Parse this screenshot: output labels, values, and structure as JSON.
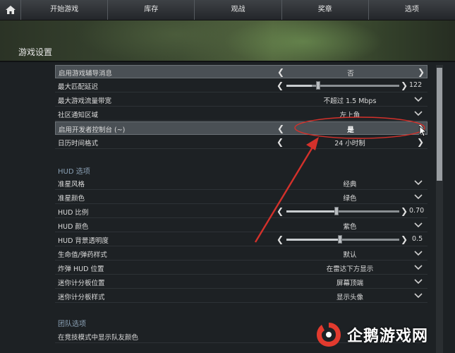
{
  "nav": {
    "items": [
      "开始游戏",
      "库存",
      "观战",
      "奖章",
      "选项"
    ]
  },
  "header": {
    "title": "游戏设置"
  },
  "settings": [
    {
      "label": "启用游戏辅导消息",
      "value": "否",
      "control": "cycle",
      "highlight": true
    },
    {
      "label": "最大匹配延迟",
      "value": "122",
      "control": "slider",
      "level": 0.3
    },
    {
      "label": "最大游戏流量带宽",
      "value": "不超过 1.5 Mbps",
      "control": "dropdown"
    },
    {
      "label": "社区通知区域",
      "value": "左上角",
      "control": "dropdown"
    },
    {
      "label": "启用开发者控制台 (~)",
      "value": "是",
      "control": "cycle",
      "highlight": true
    },
    {
      "label": "日历时间格式",
      "value": "24 小时制",
      "control": "cycle"
    }
  ],
  "hud": {
    "section_title": "HUD 选项",
    "rows": [
      {
        "label": "准星风格",
        "value": "经典",
        "control": "dropdown"
      },
      {
        "label": "准星颜色",
        "value": "绿色",
        "control": "dropdown"
      },
      {
        "label": "HUD 比例",
        "value": "0.70",
        "control": "slider",
        "level": 0.45
      },
      {
        "label": "HUD 颜色",
        "value": "紫色",
        "control": "dropdown"
      },
      {
        "label": "HUD 背景透明度",
        "value": "0.5",
        "control": "slider",
        "level": 0.48
      },
      {
        "label": "生命值/弹药样式",
        "value": "默认",
        "control": "dropdown"
      },
      {
        "label": "炸弹 HUD 位置",
        "value": "在雷达下方显示",
        "control": "dropdown"
      },
      {
        "label": "迷你计分板位置",
        "value": "屏幕顶端",
        "control": "dropdown"
      },
      {
        "label": "迷你计分板样式",
        "value": "显示头像",
        "control": "dropdown"
      }
    ]
  },
  "team": {
    "section_title": "团队选项",
    "rows": [
      {
        "label": "在竞技模式中显示队友颜色",
        "value": "",
        "control": "dropdown"
      }
    ]
  },
  "watermark": {
    "text": "企鹅游戏网"
  },
  "colors": {
    "annotation": "#d3312b",
    "section_title": "#8aa0b4",
    "highlight_row": "#4a5055"
  },
  "icons": {
    "home": "home-icon",
    "cycle_left": "chevron-left-icon",
    "cycle_right": "chevron-right-icon",
    "dropdown": "chevron-down-icon"
  }
}
